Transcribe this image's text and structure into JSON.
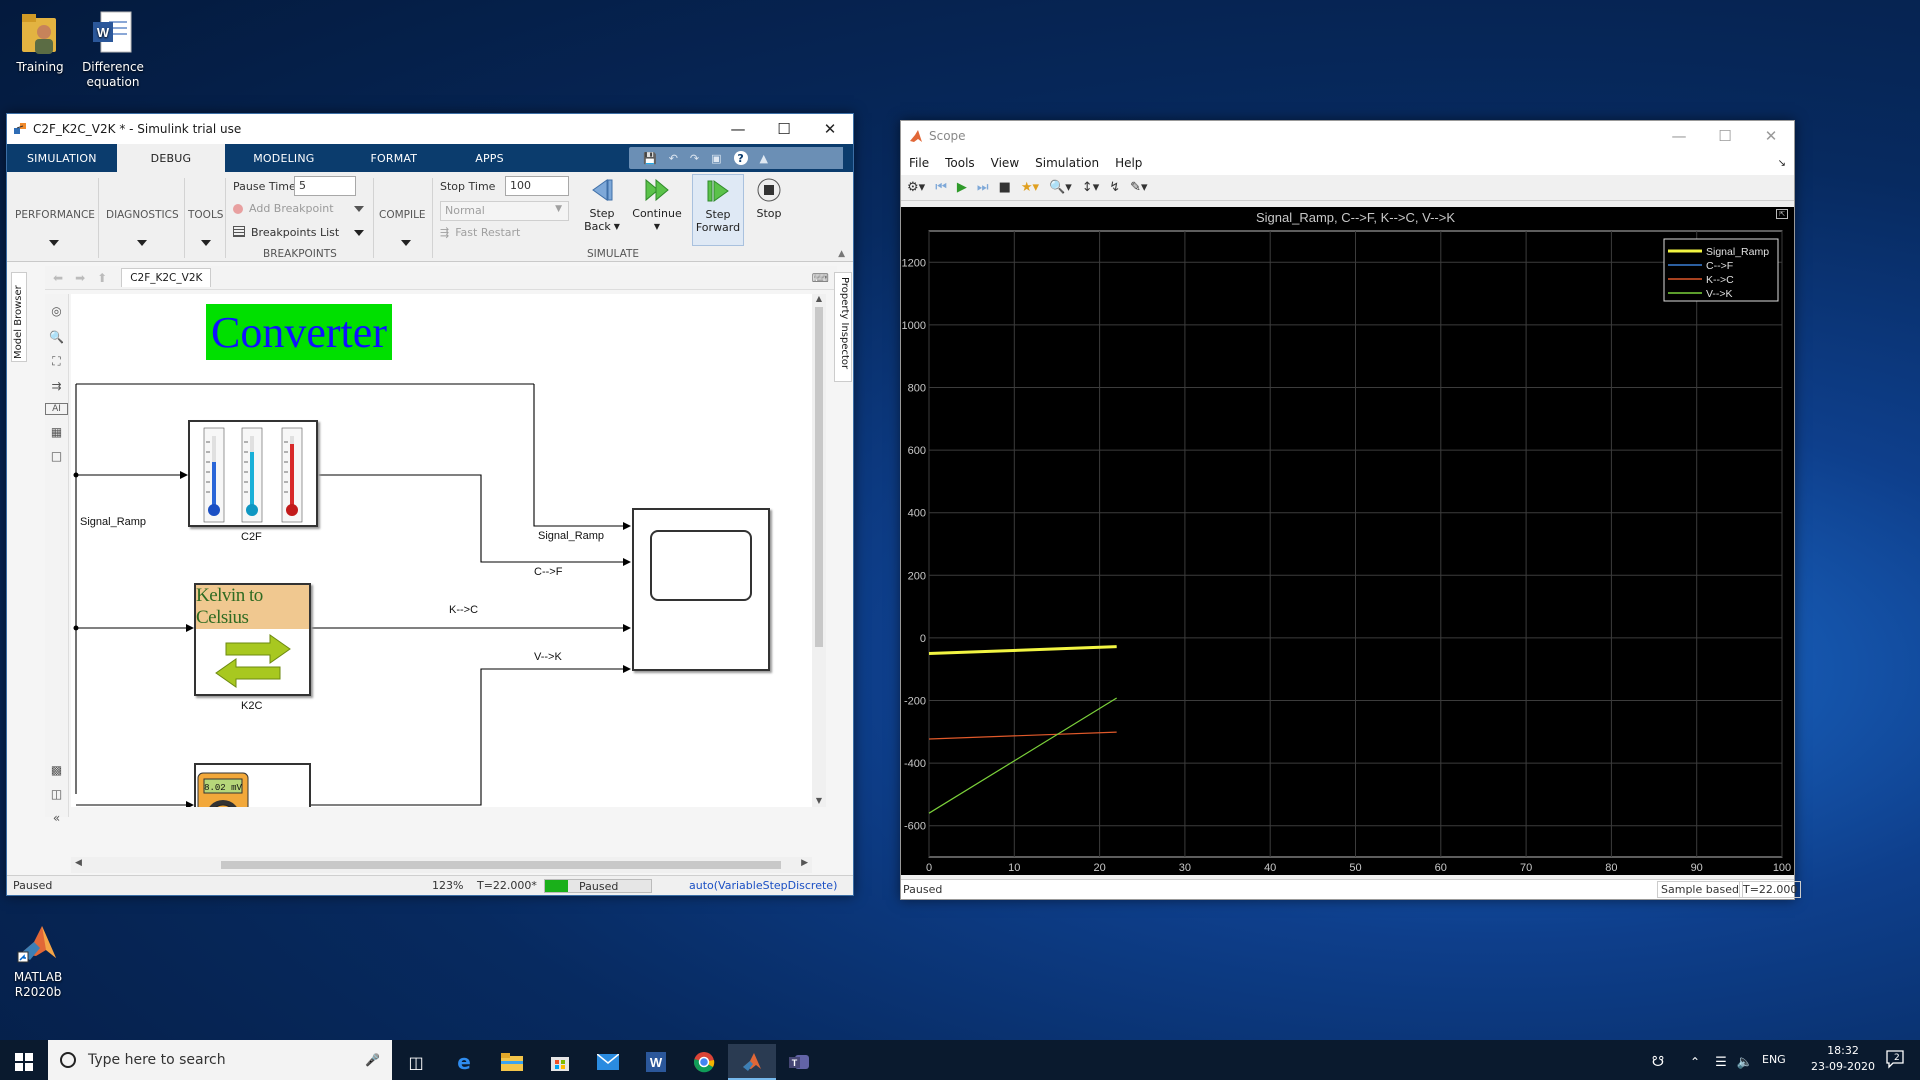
{
  "desktop": {
    "icons": [
      {
        "label_line1": "Training",
        "label_line2": ""
      },
      {
        "label_line1": "Difference",
        "label_line2": "equation"
      },
      {
        "label_line1": "MATLAB",
        "label_line2": "R2020b"
      }
    ]
  },
  "simulink": {
    "title": "C2F_K2C_V2K * - Simulink trial use",
    "tabs": [
      "SIMULATION",
      "DEBUG",
      "MODELING",
      "FORMAT",
      "APPS"
    ],
    "active_tab": "DEBUG",
    "ribbon": {
      "performance": "PERFORMANCE",
      "diagnostics": "DIAGNOSTICS",
      "tools": "TOOLS",
      "pause_time_label": "Pause Time",
      "pause_time_value": "5",
      "add_breakpoint": "Add Breakpoint",
      "breakpoints_list": "Breakpoints List",
      "breakpoints_group": "BREAKPOINTS",
      "compile": "COMPILE",
      "stop_time_label": "Stop Time",
      "stop_time_value": "100",
      "sim_mode": "Normal",
      "fast_restart": "Fast Restart",
      "step_back_1": "Step",
      "step_back_2": "Back",
      "continue": "Continue",
      "step_forward_1": "Step",
      "step_forward_2": "Forward",
      "stop": "Stop",
      "simulate_group": "SIMULATE"
    },
    "side_tabs": {
      "model_browser": "Model Browser",
      "property_inspector": "Property Inspector"
    },
    "breadcrumb_tab": "C2F_K2C_V2K",
    "canvas": {
      "converter_title": "Converter",
      "kelvin_title": "Kelvin to Celsius",
      "dmm_reading": "8.02 mV",
      "block_labels": {
        "c2f": "C2F",
        "k2c": "K2C"
      },
      "signal_labels": {
        "signal_ramp_left": "Signal_Ramp",
        "signal_ramp": "Signal_Ramp",
        "c_f": "C-->F",
        "k_c": "K-->C",
        "v_k": "V-->K"
      }
    },
    "status": {
      "left": "Paused",
      "zoom": "123%",
      "time": "T=22.000*",
      "progress_text": "Paused",
      "progress_fraction": 0.22,
      "solver": "auto(VariableStepDiscrete)"
    }
  },
  "scope": {
    "title": "Scope",
    "menu": [
      "File",
      "Tools",
      "View",
      "Simulation",
      "Help"
    ],
    "status": {
      "left": "Paused",
      "mode": "Sample based",
      "time": "T=22.000"
    },
    "colors": {
      "signal_ramp": "#f2f542",
      "c_f": "#3a7fd5",
      "k_c": "#e0592a",
      "v_k": "#7bd13a"
    }
  },
  "chart_data": {
    "type": "line",
    "title": "Signal_Ramp, C-->F, K-->C, V-->K",
    "xlim": [
      0,
      100
    ],
    "ylim": [
      -700,
      1300
    ],
    "xticks": [
      0,
      10,
      20,
      30,
      40,
      50,
      60,
      70,
      80,
      90,
      100
    ],
    "yticks": [
      -600,
      -400,
      -200,
      0,
      200,
      400,
      600,
      800,
      1000,
      1200
    ],
    "grid": true,
    "legend_position": "top-right",
    "series": [
      {
        "name": "Signal_Ramp",
        "x": [
          0,
          22
        ],
        "y": [
          -50,
          -28
        ]
      },
      {
        "name": "C-->F",
        "x": [
          0,
          22
        ],
        "y": [
          -50,
          -28
        ]
      },
      {
        "name": "K-->C",
        "x": [
          0,
          22
        ],
        "y": [
          -323,
          -301
        ]
      },
      {
        "name": "V-->K",
        "x": [
          0,
          22
        ],
        "y": [
          -560,
          -192
        ]
      }
    ]
  },
  "taskbar": {
    "search_placeholder": "Type here to search",
    "lang": "ENG",
    "time": "18:32",
    "date": "23-09-2020",
    "notif_count": "2"
  }
}
